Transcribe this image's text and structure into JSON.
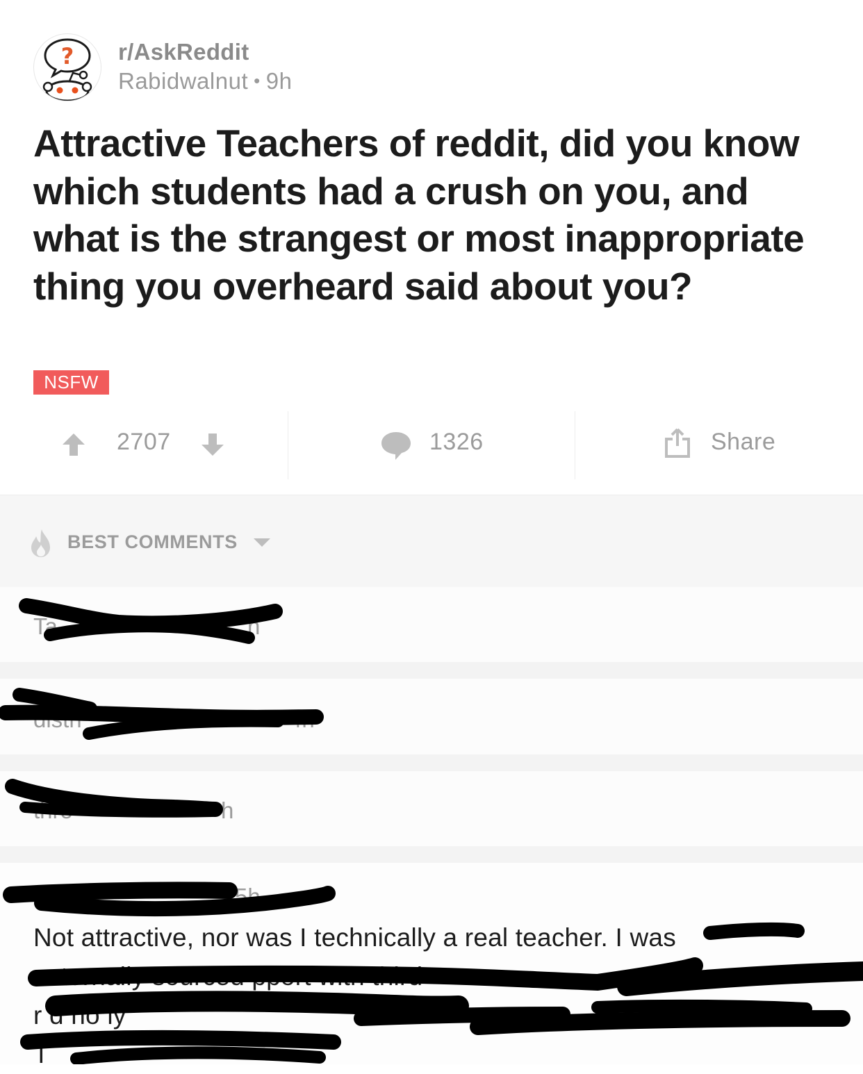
{
  "post": {
    "subreddit": "r/AskReddit",
    "author": "Rabidwalnut",
    "separator": "•",
    "age": "9h",
    "title": "Attractive Teachers of reddit, did you know which students had a crush on you, and what is the strangest or most inappropriate thing you overheard said about you?",
    "nsfw_label": "NSFW",
    "subreddit_icon": "askreddit-snoo-icon"
  },
  "actions": {
    "score": "2707",
    "comments": "1326",
    "share_label": "Share",
    "icons": [
      "upvote-icon",
      "downvote-icon",
      "comment-bubble-icon",
      "share-icon"
    ]
  },
  "comments_header": {
    "sort_label": "BEST COMMENTS",
    "icons": [
      "flame-icon",
      "caret-down-icon"
    ]
  },
  "comments": [
    {
      "meta": "Ta",
      "meta_end": "n",
      "redacted": true
    },
    {
      "meta": "distri",
      "meta_end": "4h",
      "redacted": true
    },
    {
      "meta": "thro",
      "meta_end": "h",
      "redacted": true
    },
    {
      "meta": "v",
      "meta_end": "5h",
      "body_visible": "Not attractive, nor was I technically a real teacher.",
      "body_fragments": [
        "I was",
        "externally sourced",
        "pport",
        "with third",
        "r",
        "d no",
        "ly",
        "T"
      ],
      "redacted": true
    }
  ],
  "colors": {
    "nsfw_bg": "#f15b5b",
    "muted_text": "#9b9b9b",
    "title_text": "#1c1c1c",
    "section_bg": "#f6f6f6",
    "redaction": "#000000"
  }
}
